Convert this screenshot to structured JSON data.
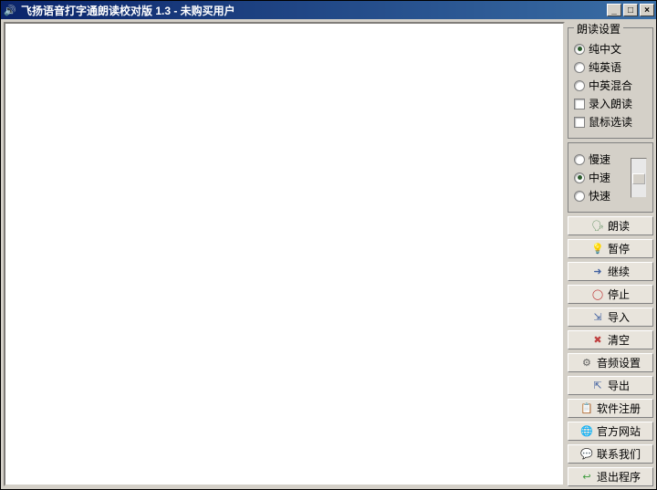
{
  "title": "飞扬语音打字通朗读校对版 1.3 - 未购买用户",
  "settings": {
    "label": "朗读设置",
    "langOptions": [
      {
        "label": "纯中文",
        "checked": true
      },
      {
        "label": "纯英语",
        "checked": false
      },
      {
        "label": "中英混合",
        "checked": false
      }
    ],
    "checkboxes": [
      {
        "label": "录入朗读",
        "checked": false
      },
      {
        "label": "鼠标选读",
        "checked": false
      }
    ]
  },
  "speed": {
    "options": [
      {
        "label": "慢速",
        "checked": false
      },
      {
        "label": "中速",
        "checked": true
      },
      {
        "label": "快速",
        "checked": false
      }
    ]
  },
  "buttons": {
    "read": "朗读",
    "pause": "暂停",
    "resume": "继续",
    "stop": "停止",
    "import": "导入",
    "clear": "清空",
    "audio": "音频设置",
    "export": "导出",
    "register": "软件注册",
    "website": "官方网站",
    "contact": "联系我们",
    "exit": "退出程序"
  }
}
